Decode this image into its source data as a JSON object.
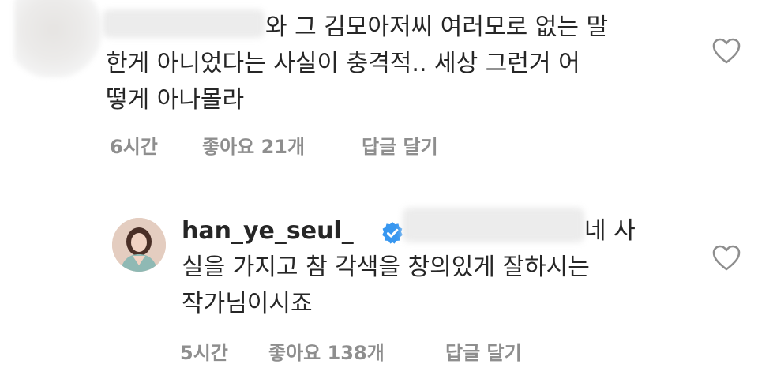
{
  "comments": [
    {
      "text_line1": "와 그 김모아저씨 여러모로 없는 말",
      "text_line2": "한게 아니었다는 사실이 충격적.. 세상 그런거 어",
      "text_line3": "떻게 아나몰라",
      "time": "6시간",
      "likes": "좋아요 21개",
      "reply": "답글 달기",
      "like_icon": "heart-outline-icon"
    },
    {
      "username": "han_ye_seul_",
      "verified_icon": "verified-badge-icon",
      "text_line1": "네 사",
      "text_line2": "실을 가지고 참 각색을 창의있게 잘하시는",
      "text_line3": "작가님이시죠",
      "time": "5시간",
      "likes": "좋아요 138개",
      "reply": "답글 달기",
      "like_icon": "heart-outline-icon"
    }
  ],
  "colors": {
    "text": "#262626",
    "meta": "#8e8e8e",
    "verified": "#3897f0"
  }
}
